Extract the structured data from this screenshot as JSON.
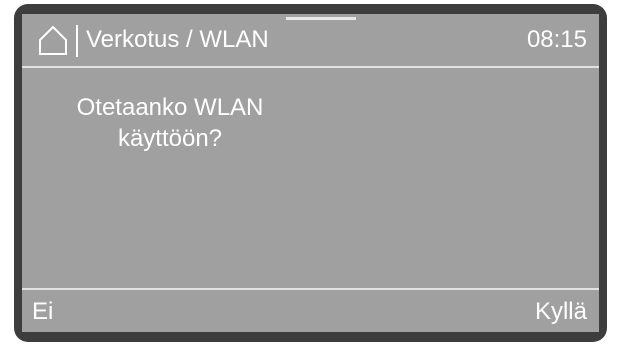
{
  "header": {
    "home_icon": "home-icon",
    "breadcrumb": "Verkotus / WLAN",
    "time": "08:15"
  },
  "dialog": {
    "question": "Otetaanko WLAN käyttöön?"
  },
  "softkeys": {
    "left_label": "Ei",
    "right_label": "Kyllä"
  },
  "colors": {
    "screen_background": "#a0a0a0",
    "bezel": "#3d3d3d",
    "text": "#ffffff"
  }
}
